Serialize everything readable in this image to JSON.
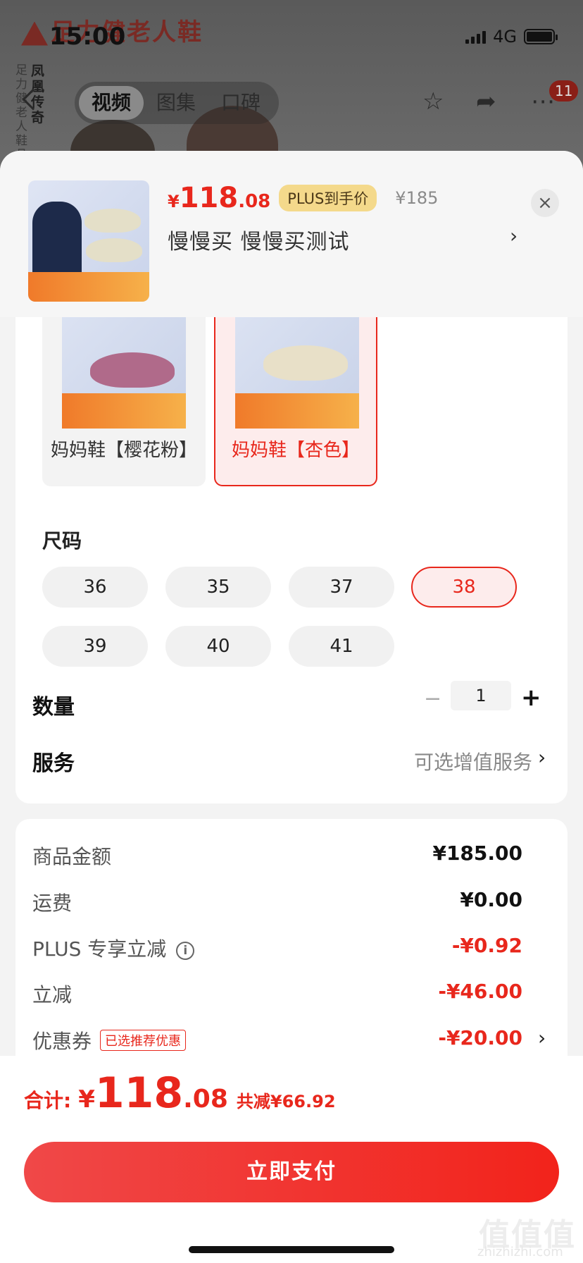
{
  "status_bar": {
    "time": "15:00",
    "network": "4G"
  },
  "background": {
    "brand_name": "足力健老人鞋",
    "vertical_text_1": "足力健老人鞋品牌",
    "vertical_text_2": "凤凰传奇",
    "tabs": [
      {
        "label": "视频",
        "active": true
      },
      {
        "label": "图集",
        "active": false
      },
      {
        "label": "口碑",
        "active": false
      }
    ],
    "badge_count": "11"
  },
  "product": {
    "currency": "¥",
    "price_int": "118",
    "price_dec": ".08",
    "plus_tag": "PLUS到手价",
    "original_price": "¥185",
    "subtitle": "慢慢买  慢慢买测试",
    "close_icon": "close-icon"
  },
  "colors": [
    {
      "label": "妈妈鞋【樱花粉】",
      "selected": false,
      "shoe_color": "#b06a8a"
    },
    {
      "label": "妈妈鞋【杏色】",
      "selected": true,
      "shoe_color": "#e8e0c8"
    }
  ],
  "size": {
    "title": "尺码",
    "options": [
      {
        "label": "36",
        "selected": false
      },
      {
        "label": "35",
        "selected": false
      },
      {
        "label": "37",
        "selected": false
      },
      {
        "label": "38",
        "selected": true
      },
      {
        "label": "39",
        "selected": false
      },
      {
        "label": "40",
        "selected": false
      },
      {
        "label": "41",
        "selected": false
      }
    ]
  },
  "quantity": {
    "title": "数量",
    "value": "1",
    "minus": "−",
    "plus": "+"
  },
  "service": {
    "title": "服务",
    "value": "可选增值服务"
  },
  "breakdown": [
    {
      "label": "商品金额",
      "value": "¥185.00",
      "red": false
    },
    {
      "label": "运费",
      "value": "¥0.00",
      "red": false
    },
    {
      "label": "PLUS 专享立减",
      "value": "-¥0.92",
      "red": true,
      "info": "i"
    },
    {
      "label": "立减",
      "value": "-¥46.00",
      "red": true
    },
    {
      "label": "优惠券",
      "value": "-¥20.00",
      "red": true,
      "tag": "已选推荐优惠",
      "arrow": true
    }
  ],
  "footer": {
    "total_label": "合计:",
    "currency": "¥",
    "total_int": "118",
    "total_dec": ".08",
    "saved": "共减¥66.92",
    "pay_button": "立即支付"
  },
  "watermark": {
    "text": "值值值",
    "sub": "zhizhizhi.com"
  },
  "colors_theme": {
    "accent": "#e8271c",
    "plus_gold": "#f4d98b"
  }
}
